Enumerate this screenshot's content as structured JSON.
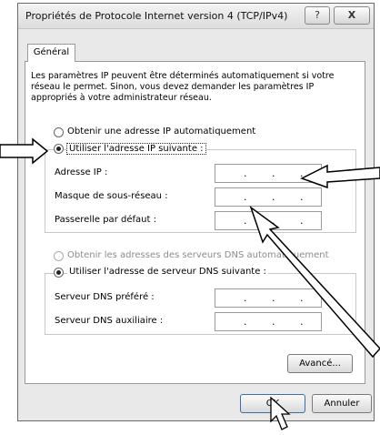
{
  "window": {
    "title": "Propriétés de Protocole Internet version 4 (TCP/IPv4)",
    "help_button": "?",
    "close_button": "X"
  },
  "tabs": [
    {
      "label": "Général"
    }
  ],
  "description": "Les paramètres IP peuvent être déterminés automatiquement si votre réseau le permet. Sinon, vous devez demander les paramètres IP appropriés à votre administrateur réseau.",
  "ip_section": {
    "auto_option": "Obtenir une adresse IP automatiquement",
    "manual_option": "Utiliser l'adresse IP suivante :",
    "selected": "manual",
    "fields": [
      {
        "label": "Adresse IP :",
        "value": ". . ."
      },
      {
        "label": "Masque de sous-réseau :",
        "value": ". . ."
      },
      {
        "label": "Passerelle par défaut :",
        "value": ". . ."
      }
    ]
  },
  "dns_section": {
    "auto_option": "Obtenir les adresses des serveurs DNS automatiquement",
    "manual_option": "Utiliser l'adresse de serveur DNS suivante :",
    "selected": "manual",
    "fields": [
      {
        "label": "Serveur DNS préféré :",
        "value": ". . ."
      },
      {
        "label": "Serveur DNS auxiliaire :",
        "value": ". . ."
      }
    ]
  },
  "buttons": {
    "advanced": "Avancé...",
    "ok": "OK",
    "cancel": "Annuler"
  },
  "icons": [
    "help-icon",
    "close-icon",
    "callout-arrow",
    "mouse-cursor-icon"
  ]
}
